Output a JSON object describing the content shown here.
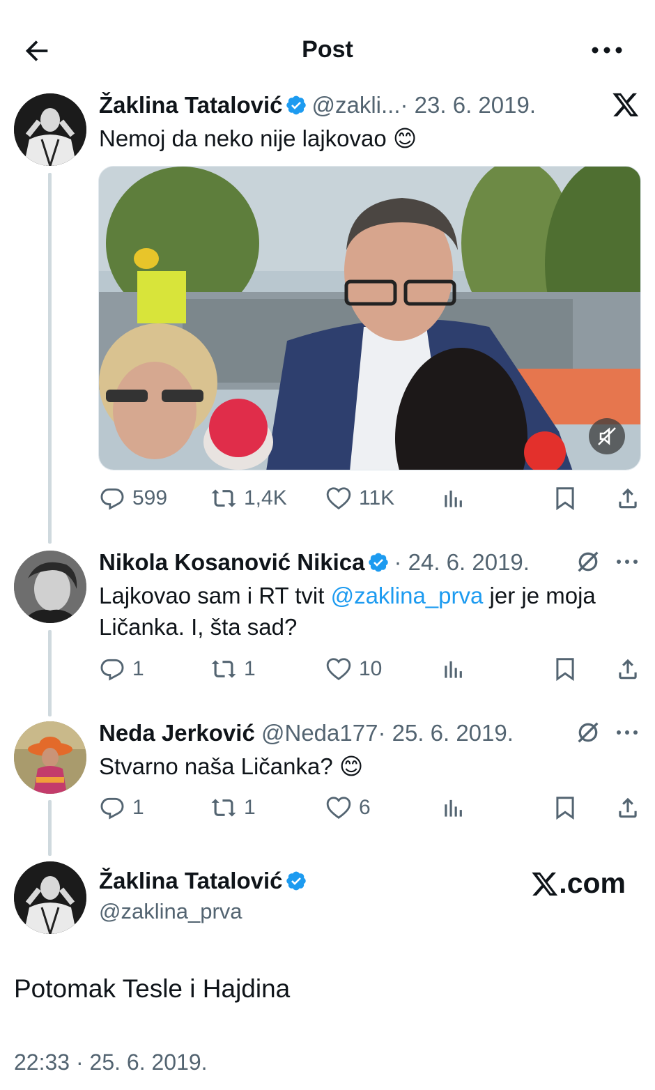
{
  "header": {
    "title": "Post"
  },
  "tweets": [
    {
      "name": "Žaklina Tatalović",
      "handle": "@zakli...",
      "date": "· 23. 6. 2019.",
      "text": "Nemoj da neko nije lajkovao 😊",
      "stats": {
        "replies": "599",
        "reposts": "1,4K",
        "likes": "11K"
      }
    },
    {
      "name": "Nikola Kosanović Nikica",
      "handle": "",
      "date": "· 24. 6. 2019.",
      "text_before": "Lajkovao sam i RT tvit ",
      "mention": "@zaklina_prva",
      "text_after": " jer je moja Ličanka. I, šta sad?",
      "stats": {
        "replies": "1",
        "reposts": "1",
        "likes": "10"
      }
    },
    {
      "name": "Neda Jerković",
      "handle": "@Neda177",
      "date": "· 25. 6. 2019.",
      "text": "Stvarno naša Ličanka? 😊",
      "stats": {
        "replies": "1",
        "reposts": "1",
        "likes": "6"
      }
    }
  ],
  "main": {
    "name": "Žaklina Tatalović",
    "handle": "@zaklina_prva",
    "text": "Potomak Tesle i Hajdina",
    "timestamp": "22:33 · 25. 6. 2019.",
    "watermark": ".com"
  },
  "colors": {
    "text": "#0f1419",
    "secondary": "#536471",
    "accent": "#1d9bf0",
    "line": "#cfd9de"
  },
  "icons": [
    "back-arrow-icon",
    "more-icon",
    "verified-icon",
    "x-logo-icon",
    "grok-icon",
    "reply-icon",
    "repost-icon",
    "like-icon",
    "views-icon",
    "bookmark-icon",
    "share-icon",
    "mute-icon"
  ]
}
